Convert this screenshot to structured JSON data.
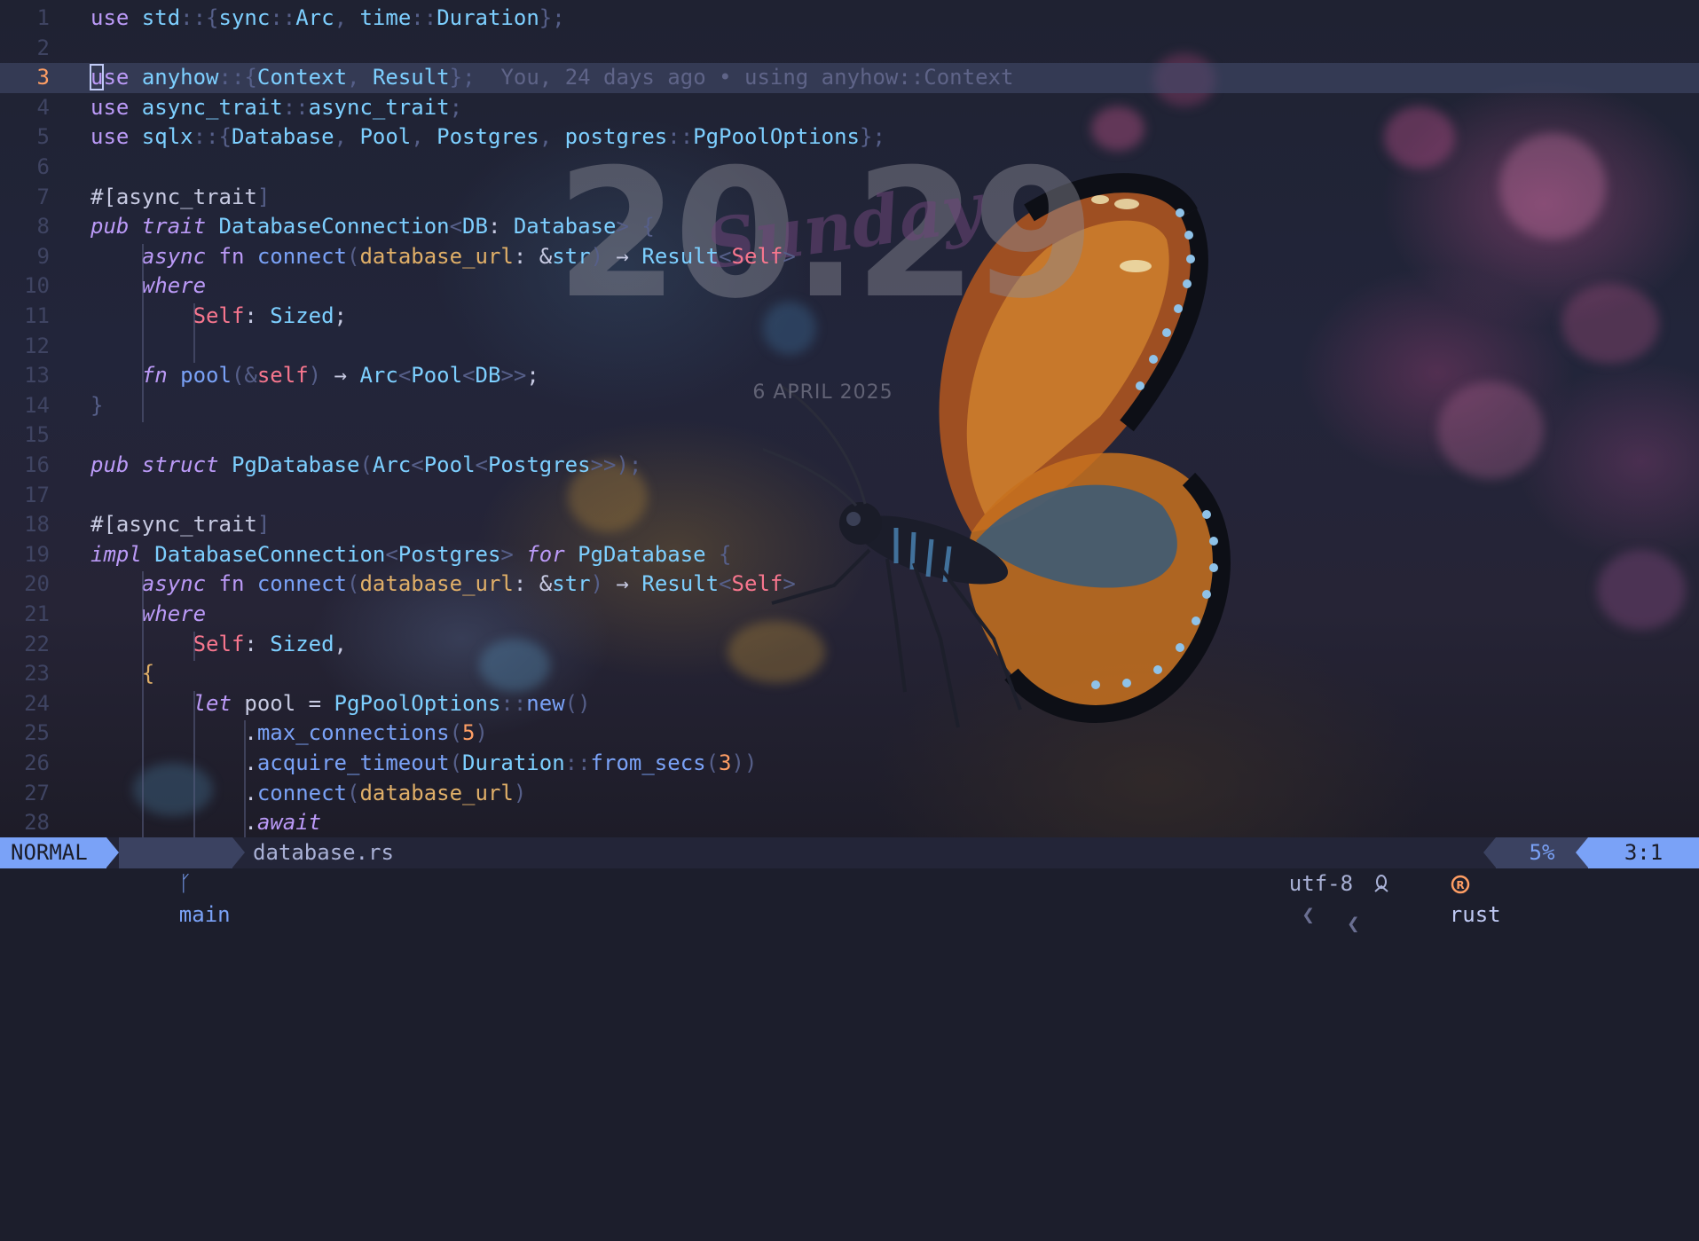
{
  "clock": {
    "time": "20.29",
    "day": "Sunday",
    "date": "6 APRIL 2025"
  },
  "editor": {
    "current_line": "3",
    "blame": "You, 24 days ago • using anyhow::Context",
    "lines": [
      {
        "n": "1"
      },
      {
        "n": "2"
      },
      {
        "n": "3"
      },
      {
        "n": "4"
      },
      {
        "n": "5"
      },
      {
        "n": "6"
      },
      {
        "n": "7"
      },
      {
        "n": "8"
      },
      {
        "n": "9"
      },
      {
        "n": "10"
      },
      {
        "n": "11"
      },
      {
        "n": "12"
      },
      {
        "n": "13"
      },
      {
        "n": "14"
      },
      {
        "n": "15"
      },
      {
        "n": "16"
      },
      {
        "n": "17"
      },
      {
        "n": "18"
      },
      {
        "n": "19"
      },
      {
        "n": "20"
      },
      {
        "n": "21"
      },
      {
        "n": "22"
      },
      {
        "n": "23"
      },
      {
        "n": "24"
      },
      {
        "n": "25"
      },
      {
        "n": "26"
      },
      {
        "n": "27"
      },
      {
        "n": "28"
      }
    ],
    "code": [
      [
        [
          "kn",
          "use "
        ],
        [
          "t",
          "std"
        ],
        [
          "d",
          "::{"
        ],
        [
          "t",
          "sync"
        ],
        [
          "d",
          "::"
        ],
        [
          "t",
          "Arc"
        ],
        [
          "d",
          ", "
        ],
        [
          "t",
          "time"
        ],
        [
          "d",
          "::"
        ],
        [
          "t",
          "Duration"
        ],
        [
          "d",
          "};"
        ]
      ],
      [],
      [
        [
          "cursor",
          "u"
        ],
        [
          "kn",
          "se "
        ],
        [
          "t",
          "anyhow"
        ],
        [
          "d",
          "::{"
        ],
        [
          "t",
          "Context"
        ],
        [
          "d",
          ", "
        ],
        [
          "t",
          "Result"
        ],
        [
          "d",
          "};"
        ]
      ],
      [
        [
          "kn",
          "use "
        ],
        [
          "t",
          "async_trait"
        ],
        [
          "d",
          "::"
        ],
        [
          "t",
          "async_trait"
        ],
        [
          "d",
          ";"
        ]
      ],
      [
        [
          "kn",
          "use "
        ],
        [
          "t",
          "sqlx"
        ],
        [
          "d",
          "::{"
        ],
        [
          "t",
          "Database"
        ],
        [
          "d",
          ", "
        ],
        [
          "t",
          "Pool"
        ],
        [
          "d",
          ", "
        ],
        [
          "t",
          "Postgres"
        ],
        [
          "d",
          ", "
        ],
        [
          "t",
          "postgres"
        ],
        [
          "d",
          "::"
        ],
        [
          "t",
          "PgPoolOptions"
        ],
        [
          "d",
          "};"
        ]
      ],
      [],
      [
        [
          "x",
          "#["
        ],
        [
          "x",
          "async_trait"
        ],
        [
          "d",
          "]"
        ]
      ],
      [
        [
          "k",
          "pub "
        ],
        [
          "k",
          "trait "
        ],
        [
          "t",
          "DatabaseConnection"
        ],
        [
          "d",
          "<"
        ],
        [
          "t",
          "DB"
        ],
        [
          "x",
          ": "
        ],
        [
          "t",
          "Database"
        ],
        [
          "d",
          "> {"
        ]
      ],
      [
        [
          "x",
          "    "
        ],
        [
          "k",
          "async "
        ],
        [
          "kn",
          "fn "
        ],
        [
          "f",
          "connect"
        ],
        [
          "d",
          "("
        ],
        [
          "p",
          "database_url"
        ],
        [
          "x",
          ": &"
        ],
        [
          "t",
          "str"
        ],
        [
          "d",
          ") "
        ],
        [
          "x",
          "→ "
        ],
        [
          "t",
          "Result"
        ],
        [
          "d",
          "<"
        ],
        [
          "s",
          "Self"
        ],
        [
          "d",
          ">"
        ]
      ],
      [
        [
          "x",
          "    "
        ],
        [
          "k",
          "where"
        ]
      ],
      [
        [
          "x",
          "        "
        ],
        [
          "s",
          "Self"
        ],
        [
          "x",
          ": "
        ],
        [
          "t",
          "Sized"
        ],
        [
          "x",
          ";"
        ]
      ],
      [],
      [
        [
          "x",
          "    "
        ],
        [
          "k",
          "fn "
        ],
        [
          "f",
          "pool"
        ],
        [
          "d",
          "(&"
        ],
        [
          "s",
          "self"
        ],
        [
          "d",
          ") "
        ],
        [
          "x",
          "→ "
        ],
        [
          "t",
          "Arc"
        ],
        [
          "d",
          "<"
        ],
        [
          "t",
          "Pool"
        ],
        [
          "d",
          "<"
        ],
        [
          "t",
          "DB"
        ],
        [
          "d",
          ">>"
        ],
        [
          "x",
          ";"
        ]
      ],
      [
        [
          "d",
          "}"
        ]
      ],
      [],
      [
        [
          "k",
          "pub "
        ],
        [
          "k",
          "struct "
        ],
        [
          "t",
          "PgDatabase"
        ],
        [
          "d",
          "("
        ],
        [
          "t",
          "Arc"
        ],
        [
          "d",
          "<"
        ],
        [
          "t",
          "Pool"
        ],
        [
          "d",
          "<"
        ],
        [
          "t",
          "Postgres"
        ],
        [
          "d",
          ">>);"
        ]
      ],
      [],
      [
        [
          "x",
          "#["
        ],
        [
          "x",
          "async_trait"
        ],
        [
          "d",
          "]"
        ]
      ],
      [
        [
          "k",
          "impl "
        ],
        [
          "t",
          "DatabaseConnection"
        ],
        [
          "d",
          "<"
        ],
        [
          "t",
          "Postgres"
        ],
        [
          "d",
          "> "
        ],
        [
          "k",
          "for "
        ],
        [
          "t",
          "PgDatabase"
        ],
        [
          "d",
          " {"
        ]
      ],
      [
        [
          "x",
          "    "
        ],
        [
          "k",
          "async "
        ],
        [
          "kn",
          "fn "
        ],
        [
          "f",
          "connect"
        ],
        [
          "d",
          "("
        ],
        [
          "p",
          "database_url"
        ],
        [
          "x",
          ": &"
        ],
        [
          "t",
          "str"
        ],
        [
          "d",
          ") "
        ],
        [
          "x",
          "→ "
        ],
        [
          "t",
          "Result"
        ],
        [
          "d",
          "<"
        ],
        [
          "s",
          "Self"
        ],
        [
          "d",
          ">"
        ]
      ],
      [
        [
          "x",
          "    "
        ],
        [
          "k",
          "where"
        ]
      ],
      [
        [
          "x",
          "        "
        ],
        [
          "s",
          "Self"
        ],
        [
          "x",
          ": "
        ],
        [
          "t",
          "Sized"
        ],
        [
          "x",
          ","
        ]
      ],
      [
        [
          "x",
          "    "
        ],
        [
          "p",
          "{"
        ]
      ],
      [
        [
          "x",
          "        "
        ],
        [
          "k",
          "let "
        ],
        [
          "x",
          "pool = "
        ],
        [
          "t",
          "PgPoolOptions"
        ],
        [
          "d",
          "::"
        ],
        [
          "f",
          "new"
        ],
        [
          "d",
          "()"
        ]
      ],
      [
        [
          "x",
          "            ."
        ],
        [
          "f",
          "max_connections"
        ],
        [
          "d",
          "("
        ],
        [
          "n",
          "5"
        ],
        [
          "d",
          ")"
        ]
      ],
      [
        [
          "x",
          "            ."
        ],
        [
          "f",
          "acquire_timeout"
        ],
        [
          "d",
          "("
        ],
        [
          "t",
          "Duration"
        ],
        [
          "d",
          "::"
        ],
        [
          "f",
          "from_secs"
        ],
        [
          "d",
          "("
        ],
        [
          "n",
          "3"
        ],
        [
          "d",
          "))"
        ]
      ],
      [
        [
          "x",
          "            ."
        ],
        [
          "f",
          "connect"
        ],
        [
          "d",
          "("
        ],
        [
          "p",
          "database_url"
        ],
        [
          "d",
          ")"
        ]
      ],
      [
        [
          "x",
          "            ."
        ],
        [
          "k",
          "await"
        ]
      ]
    ]
  },
  "statusline": {
    "mode": "NORMAL",
    "branch_icon": "git-branch-icon",
    "branch": "main",
    "file": "database.rs",
    "encoding": "utf-8",
    "os_icon": "linux-icon",
    "lang_icon": "rust-icon",
    "language": "rust",
    "percent": "5%",
    "position": "3:1"
  },
  "colors": {
    "mode_bg": "#7aa2f7",
    "keyword": "#bb9af7",
    "type": "#7dcfff",
    "function": "#7aa2f7",
    "param": "#e0af68",
    "self": "#f7768e",
    "number": "#ff9e64"
  }
}
